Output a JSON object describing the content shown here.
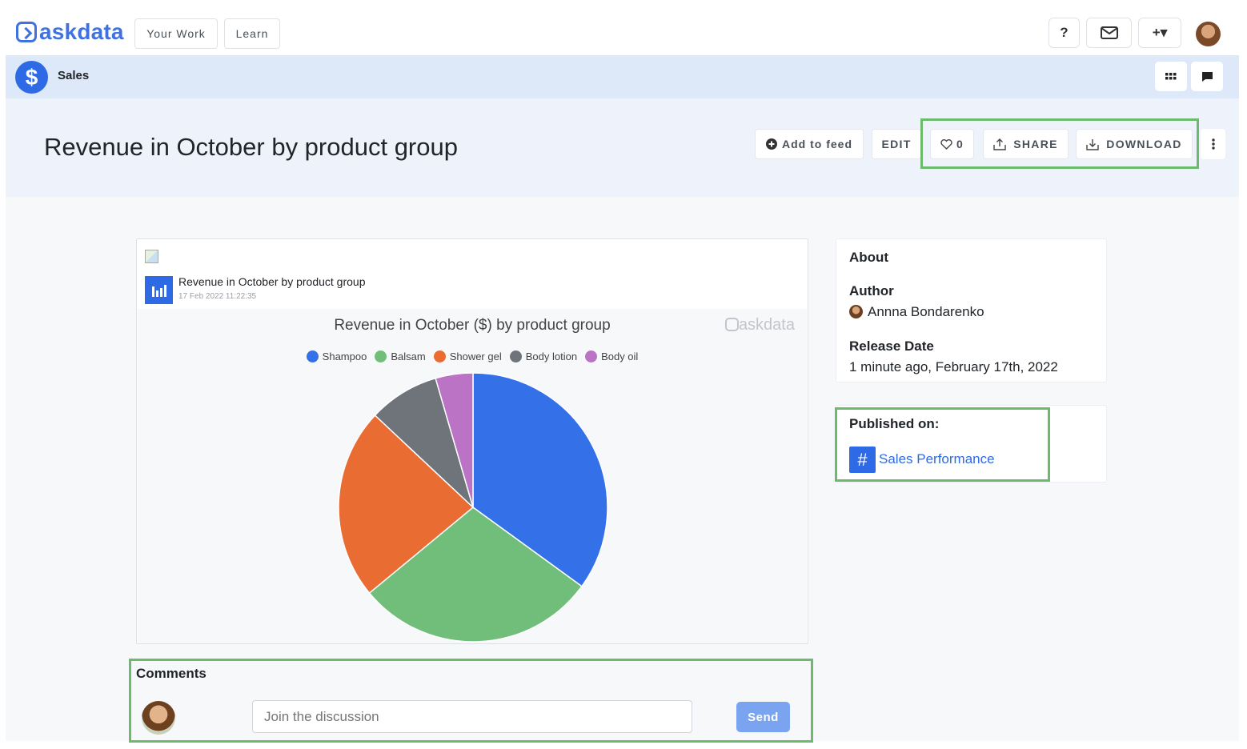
{
  "topnav": {
    "logo_text": "askdata",
    "your_work": "Your Work",
    "learn": "Learn",
    "help": "?",
    "add": "+▾"
  },
  "breadcrumb": {
    "label": "Sales",
    "icon": "$"
  },
  "page": {
    "title": "Revenue in October by product group",
    "add_to_feed": "Add to feed",
    "edit": "EDIT",
    "likes": "0",
    "share": "SHARE",
    "download": "DOWNLOAD"
  },
  "card": {
    "title": "Revenue in October by product group",
    "date": "17 Feb 2022 11:22:35",
    "watermark": "askdata"
  },
  "chart_data": {
    "type": "pie",
    "title": "Revenue in October ($) by product group",
    "legend_position": "top",
    "categories": [
      "Shampoo",
      "Balsam",
      "Shower gel",
      "Body lotion",
      "Body oil"
    ],
    "values": [
      35,
      29,
      23,
      8.5,
      4.5
    ],
    "colors": [
      "#3471e8",
      "#70be7a",
      "#e96d33",
      "#6e747a",
      "#bb73c5"
    ]
  },
  "about": {
    "heading": "About",
    "author_label": "Author",
    "author": "Annna Bondarenko",
    "release_label": "Release Date",
    "release_value": "1 minute ago, February 17th, 2022"
  },
  "published": {
    "heading": "Published on:",
    "channel": "Sales Performance",
    "hash": "#"
  },
  "comments": {
    "title": "Comments",
    "placeholder": "Join the discussion",
    "send": "Send"
  }
}
